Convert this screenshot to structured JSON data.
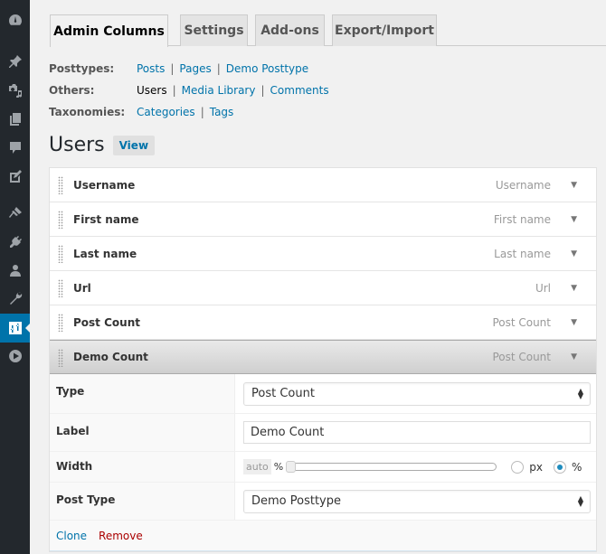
{
  "sidebar": {
    "items": [
      {
        "icon": "dashboard-icon"
      },
      {
        "icon": "pin-icon"
      },
      {
        "icon": "media-icon"
      },
      {
        "icon": "pages-icon"
      },
      {
        "icon": "comments-icon"
      },
      {
        "icon": "feedback-icon"
      },
      {
        "icon": "appearance-icon"
      },
      {
        "icon": "plugins-icon"
      },
      {
        "icon": "users-icon"
      },
      {
        "icon": "tools-icon"
      },
      {
        "icon": "admin-columns-icon",
        "active": true
      },
      {
        "icon": "play-icon"
      }
    ],
    "active_color": "#0073aa"
  },
  "tabs": [
    {
      "label": "Admin Columns",
      "active": true
    },
    {
      "label": "Settings"
    },
    {
      "label": "Add-ons"
    },
    {
      "label": "Export/Import"
    }
  ],
  "nav": {
    "posttypes": {
      "label": "Posttypes:",
      "links": [
        "Posts",
        "Pages",
        "Demo Posttype"
      ]
    },
    "others": {
      "label": "Others:",
      "links": [
        "Users",
        "Media Library",
        "Comments"
      ],
      "current": "Users"
    },
    "taxonomies": {
      "label": "Taxonomies:",
      "links": [
        "Categories",
        "Tags"
      ]
    }
  },
  "heading": {
    "title": "Users",
    "view_label": "View"
  },
  "columns": [
    {
      "name": "Username",
      "type": "Username"
    },
    {
      "name": "First name",
      "type": "First name"
    },
    {
      "name": "Last name",
      "type": "Last name"
    },
    {
      "name": "Url",
      "type": "Url"
    },
    {
      "name": "Post Count",
      "type": "Post Count"
    },
    {
      "name": "Demo Count",
      "type": "Post Count",
      "open": true
    }
  ],
  "settings": {
    "type": {
      "label": "Type",
      "value": "Post Count"
    },
    "label": {
      "label": "Label",
      "value": "Demo Count"
    },
    "width": {
      "label": "Width",
      "value": "auto",
      "unit_label": "%",
      "slider_value": 0,
      "options": [
        "px",
        "%"
      ],
      "selected": "%"
    },
    "post_type": {
      "label": "Post Type",
      "value": "Demo Posttype"
    }
  },
  "actions": {
    "clone": "Clone",
    "remove": "Remove"
  },
  "glyphs": {
    "toggle": "▼",
    "sep": "|",
    "arrows_up": "▲",
    "arrows_down": "▼"
  }
}
